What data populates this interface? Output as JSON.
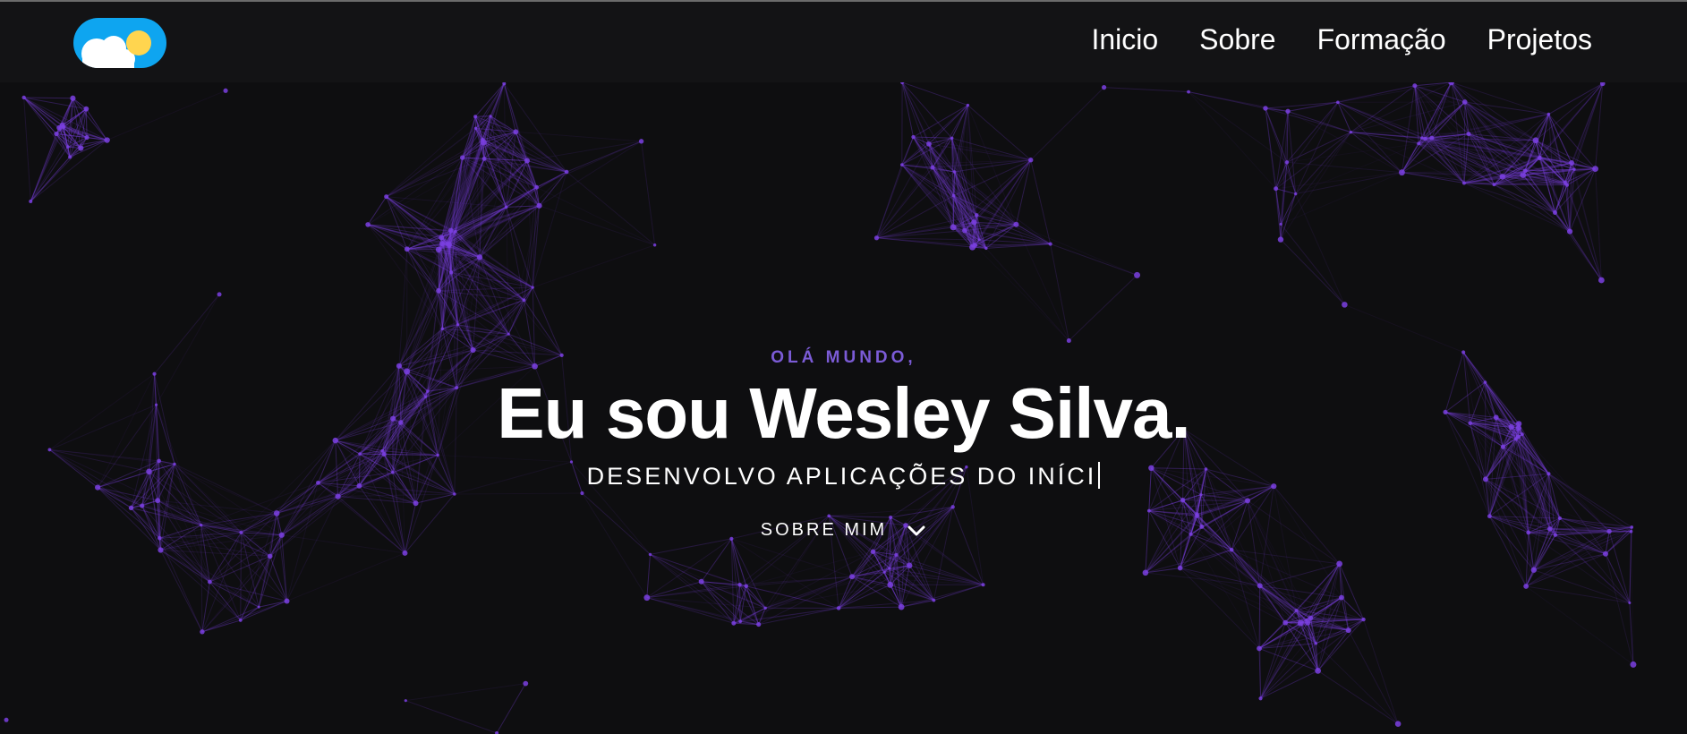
{
  "colors": {
    "background": "#0e0e10",
    "navbar": "#131315",
    "accent": "#7b5bd6",
    "particle": "#7a3fe0",
    "toggle": "#0ea5f0",
    "sun": "#ffd54f"
  },
  "navbar": {
    "toggle_icon": "theme-toggle-cloud-sun",
    "links": [
      {
        "label": "Inicio"
      },
      {
        "label": "Sobre"
      },
      {
        "label": "Formação"
      },
      {
        "label": "Projetos"
      }
    ]
  },
  "hero": {
    "greeting": "OLÁ MUNDO,",
    "headline": "Eu sou Wesley Silva.",
    "typing_text": "DESENVOLVO APLICAÇÕES DO INÍCI",
    "cta_label": "SOBRE MIM",
    "cta_icon": "chevron-down-icon"
  }
}
